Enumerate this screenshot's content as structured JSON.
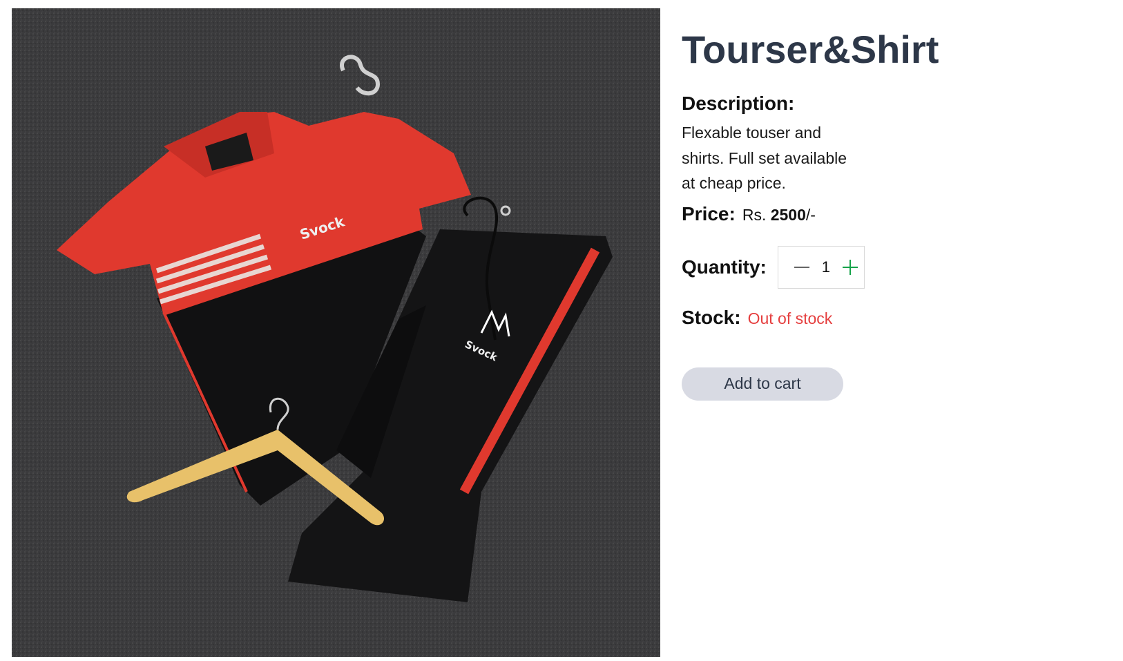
{
  "product": {
    "title": "Tourser&Shirt",
    "image_name": "tracksuit-photo",
    "description_label": "Description:",
    "description": "Flexable touser and shirts. Full set available at cheap price.",
    "price_label": "Price:",
    "price_currency": "Rs.",
    "price_amount": "2500",
    "price_suffix": "/-",
    "quantity_label": "Quantity:",
    "quantity_value": "1",
    "stock_label": "Stock:",
    "stock_status": "Out of stock",
    "add_to_cart_label": "Add to cart"
  },
  "image_text": {
    "shirt_brand": "Svock",
    "pants_brand": "Svock"
  },
  "icons": {
    "decrease": "minus-icon",
    "increase": "plus-icon"
  },
  "colors": {
    "title": "#2d3748",
    "stock_out": "#e53e3e",
    "plus_icon": "#16a34a",
    "button_bg": "#d8dae3",
    "shirt_red": "#e0392e",
    "carpet": "#3a3a3c"
  }
}
